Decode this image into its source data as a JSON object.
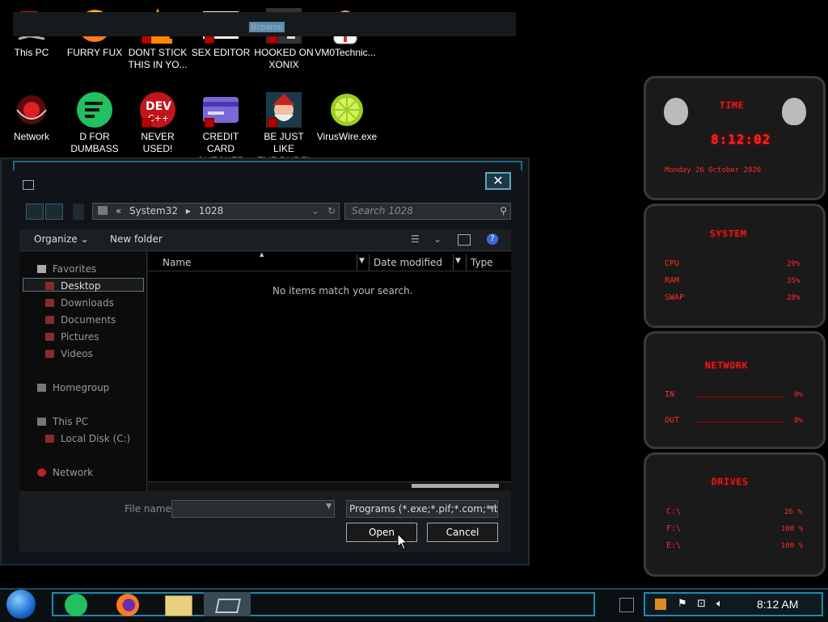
{
  "desktop": {
    "icons": [
      {
        "label": "This PC",
        "icon": "computer-icon"
      },
      {
        "label": "FURRY FUX",
        "icon": "firefox-icon"
      },
      {
        "label": "DONT STICK\nTHIS IN YO...",
        "icon": "vlc-icon"
      },
      {
        "label": "SEX EDITOR",
        "icon": "hex-editor-icon"
      },
      {
        "label": "HOOKED ON\nXONIX",
        "icon": "game-icon"
      },
      {
        "label": "VM0Technic...",
        "icon": "doctor-icon"
      },
      {
        "label": "Network",
        "icon": "network-icon"
      },
      {
        "label": "D FOR\nDUMBASS",
        "icon": "chat-icon"
      },
      {
        "label": "NEVER USED!",
        "icon": "dev-icon"
      },
      {
        "label": "CREDIT CARD\nCHECKER",
        "icon": "card-icon"
      },
      {
        "label": "BE JUST LIKE\nTHE DUDE!",
        "icon": "santa-icon"
      },
      {
        "label": "VirusWire.exe",
        "icon": "lime-icon"
      }
    ]
  },
  "dialog": {
    "title": "Browse",
    "address": {
      "prefix": "«",
      "segments": [
        "System32",
        "1028"
      ]
    },
    "search_placeholder": "Search 1028",
    "organize": "Organize",
    "new_folder": "New folder",
    "nav": {
      "favorites": "Favorites",
      "favorites_items": [
        "Desktop",
        "Downloads",
        "Documents",
        "Pictures",
        "Videos"
      ],
      "homegroup": "Homegroup",
      "this_pc": "This PC",
      "local_disk": "Local Disk (C:)",
      "network": "Network"
    },
    "columns": [
      "Name",
      "Date modified",
      "Type"
    ],
    "empty_message": "No items match your search.",
    "file_name_label": "File name:",
    "file_name_value": "",
    "file_type": "Programs (*.exe;*.pif;*.com;*.ba",
    "open_label": "Open",
    "cancel_label": "Cancel"
  },
  "gadgets": {
    "time": {
      "title": "TIME",
      "clock": "8:12:02",
      "date": "Monday 26 October 2020"
    },
    "system": {
      "title": "SYSTEM",
      "rows": [
        {
          "label": "CPU",
          "value": "29%"
        },
        {
          "label": "RAM",
          "value": "35%"
        },
        {
          "label": "SWAP",
          "value": "28%"
        }
      ]
    },
    "network": {
      "title": "NETWORK",
      "rows": [
        {
          "label": "IN",
          "value": "0%"
        },
        {
          "label": "OUT",
          "value": "0%"
        }
      ]
    },
    "drives": {
      "title": "DRIVES",
      "rows": [
        {
          "label": "C:\\",
          "value": "26 %"
        },
        {
          "label": "F:\\",
          "value": "100 %"
        },
        {
          "label": "E:\\",
          "value": "100 %"
        }
      ]
    }
  },
  "taskbar": {
    "clock": "8:12 AM"
  },
  "colors": {
    "accent": "#1e8ab0",
    "gadget_red": "#ff2020"
  }
}
